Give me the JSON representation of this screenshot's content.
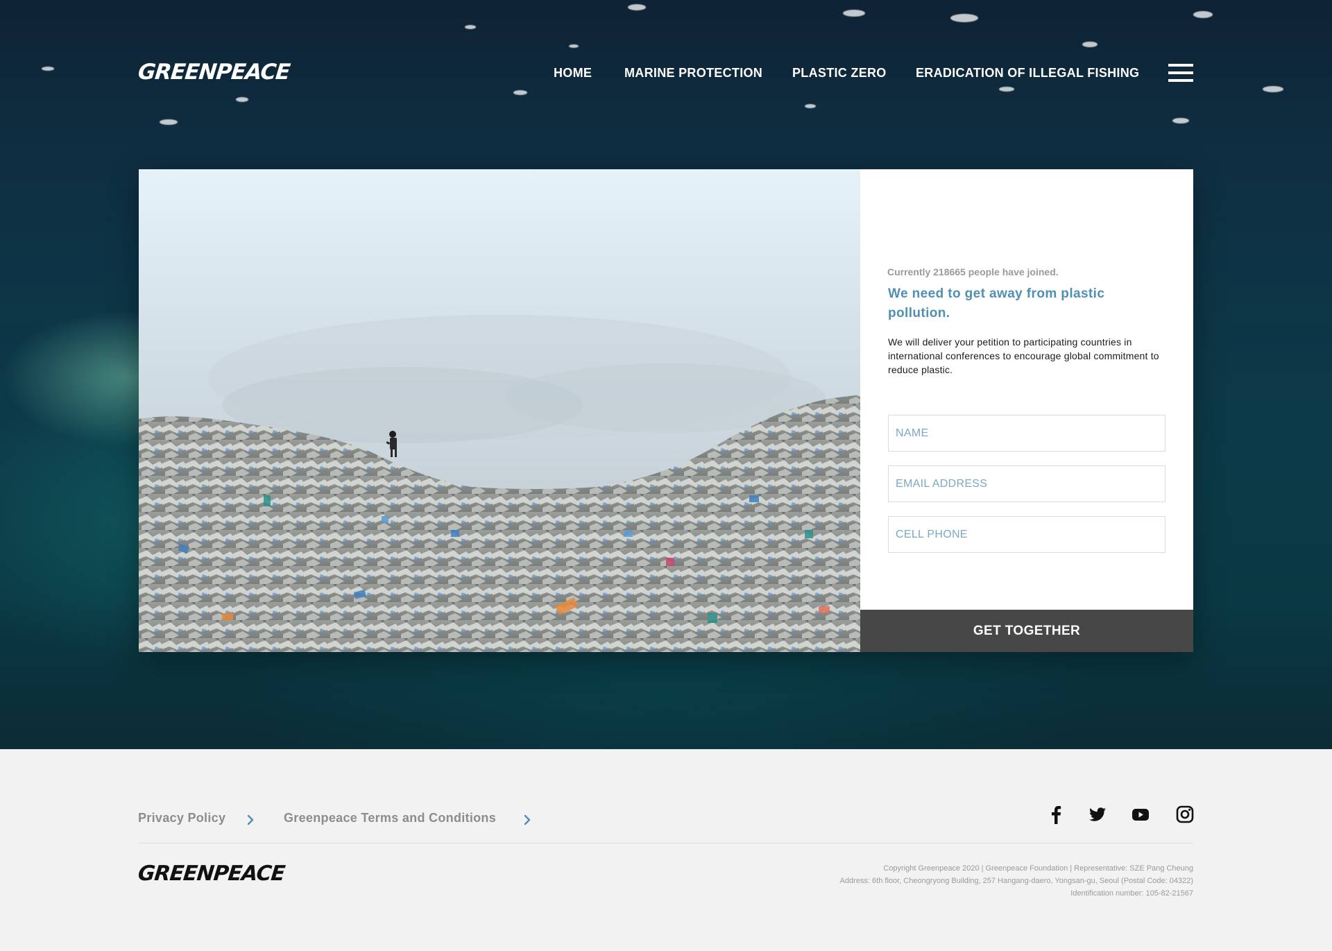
{
  "brand": {
    "logo_text": "GREENPEACE"
  },
  "nav": {
    "items": [
      {
        "label": "HOME"
      },
      {
        "label": "MARINE PROTECTION"
      },
      {
        "label": "PLASTIC ZERO"
      },
      {
        "label": "ERADICATION OF ILLEGAL FISHING"
      }
    ],
    "menu_icon": "hamburger-icon"
  },
  "petition": {
    "joined_text": "Currently 218665 people have joined.",
    "headline": "We need to get away from plastic pollution.",
    "body": "We will deliver your petition to participating countries in international conferences to encourage global commitment to reduce plastic.",
    "fields": {
      "name_placeholder": "NAME",
      "email_placeholder": "EMAIL ADDRESS",
      "phone_placeholder": "CELL PHONE"
    },
    "submit_label": "GET TOGETHER"
  },
  "footer": {
    "links": [
      {
        "label": "Privacy Policy",
        "icon": "chevron-right-icon"
      },
      {
        "label": "Greenpeace Terms and Conditions",
        "icon": "chevron-right-icon"
      }
    ],
    "social": [
      "facebook-icon",
      "twitter-icon",
      "youtube-icon",
      "instagram-icon"
    ],
    "logo_text": "GREENPEACE",
    "copyright": [
      "Copyright Greenpeace 2020 | Greenpeace Foundation | Representative: SZE Pang Cheung",
      "Address: 6th floor, Cheongryong Building, 257 Hangang-daero, Yongsan-gu, Seoul (Postal Code: 04322)",
      "Identification number: 105-82-21567"
    ]
  },
  "colors": {
    "accent_blue": "#4f8fb5",
    "button_dark": "#474747",
    "footer_bg": "#f2f2f2",
    "ocean_dark": "#0d3446"
  }
}
